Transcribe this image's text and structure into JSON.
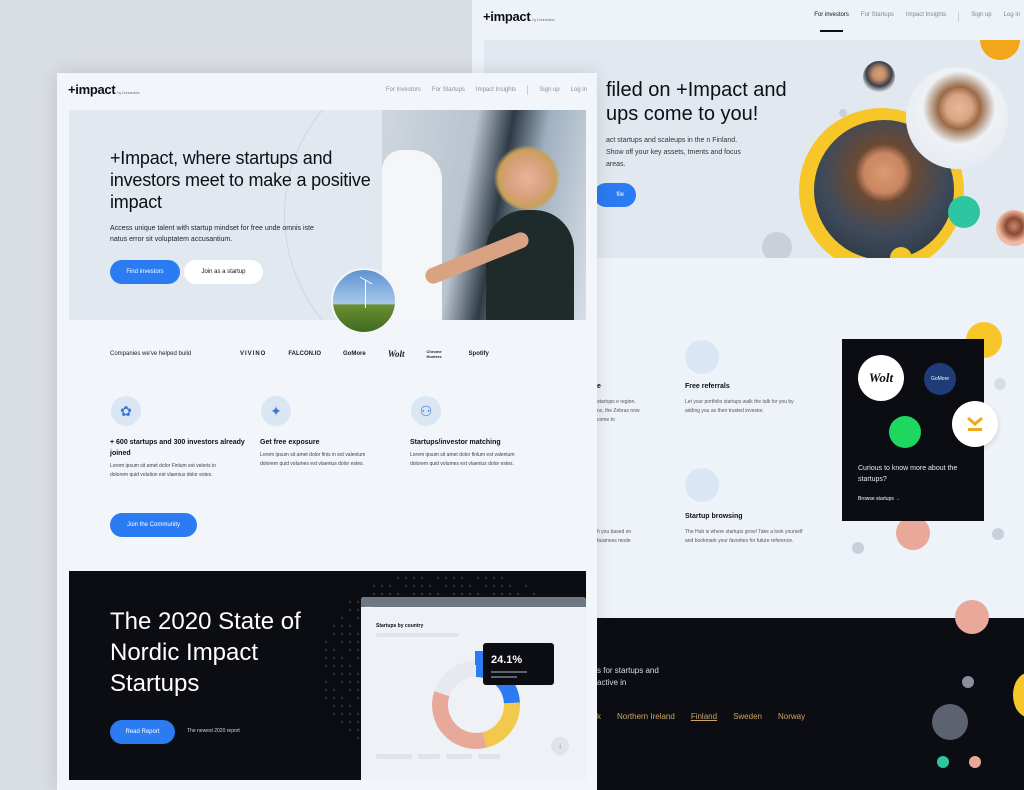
{
  "back_page": {
    "logo": "+impact",
    "logo_sub": "by Connectors",
    "nav": [
      "For investors",
      "For Startups",
      "Impact Insights",
      "Sign up",
      "Log in"
    ],
    "hero_title": "filed on +Impact and ups come to you!",
    "hero_text": "act startups and scaleups in the n Finland. Show off your key assets, tments and focus areas.",
    "hero_button": "file",
    "hero_small": "",
    "section_heading": "ur",
    "features": [
      {
        "title": "Free referrals",
        "text": "Let your portfolio startups walk the talk for you by adding you as their trusted investor."
      },
      {
        "title": "Startup browsing",
        "text": "The Hub is where startups grow! Take a look yourself and bookmark your favorites for future reference."
      }
    ],
    "cropped_feature_title": "e",
    "cropped_feature_text": "startups e region, ns, the Zebras now come to",
    "cropped_feature_text2": "h you based on business mode",
    "card": {
      "question": "Curious to know more about the startups?",
      "link": "Browse startups →",
      "logos": [
        "Wolt",
        "GoMore"
      ]
    },
    "dark": {
      "text": "s for startups and active in",
      "countries": [
        "k",
        "Northern Ireland",
        "Finland",
        "Sweden",
        "Norway"
      ]
    }
  },
  "front_page": {
    "logo": "+impact",
    "logo_sub": "by Connectors",
    "nav": [
      "For Investors",
      "For Startups",
      "Impact Insights",
      "Sign up",
      "Log in"
    ],
    "hero": {
      "title": "+Impact, where startups and investors meet to make a positive impact",
      "text": "Access unique talent with startup mindset for free unde omnis iste natus error sit voluptatem accusantium.",
      "primary_button": "Find investors",
      "secondary_button": "Join as a startup"
    },
    "logos_label": "Companies we've helped build",
    "brands": [
      "VIVINO",
      "FALCON.IO",
      "GoMore",
      "Wolt",
      "Chrome Hunters",
      "Spotify"
    ],
    "features": [
      {
        "title": "+ 600 startups and 300 investors already joined",
        "text": "Lorem ipsum sit amet dolor Finlum est veleris in dolorem quid volution est vlaenius dolor estes."
      },
      {
        "title": "Get free exposure",
        "text": "Lorem ipsum sit amet dolor finis in est valenium dolorem quid volumes est vlaenius dolor estes."
      },
      {
        "title": "Startups/investor matching",
        "text": "Lorem ipsum sit amet dolor finlum est valenium dolorem quid volumes est vlaenius dolor estes."
      }
    ],
    "join_button": "Join the Community",
    "report": {
      "title": "The 2020 State of Nordic Impact Startups",
      "button": "Read Report",
      "sub": "The newest 2020 report",
      "widget_title": "Startups by country",
      "tooltip_value": "24.1%"
    }
  },
  "chart_data": {
    "type": "pie",
    "title": "Startups by country",
    "values": [
      24.1,
      22,
      34,
      19.9
    ],
    "colors": [
      "#2b7bf2",
      "#f2c94c",
      "#e8a89a",
      "#e6e9ef"
    ]
  }
}
